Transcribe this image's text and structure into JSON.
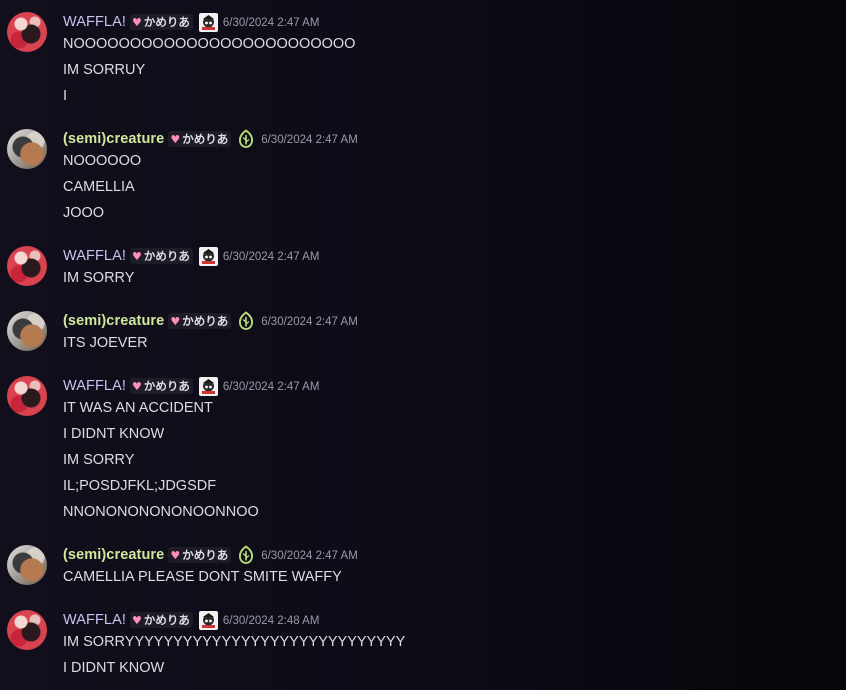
{
  "users": {
    "waffla": {
      "name": "WAFFLA!",
      "tag": "かめりあ",
      "color": "#c9c2f2"
    },
    "creature": {
      "name": "(semi)creature",
      "tag": "かめりあ",
      "color": "#cfe89c"
    }
  },
  "icons": {
    "tag_heart": "heart-icon",
    "waffla_role": "anime-character-role-icon",
    "creature_role": "leaf-role-icon"
  },
  "messages": [
    {
      "author": "WAFFLA!",
      "tag": "かめりあ",
      "timestamp": "6/30/2024 2:47 AM",
      "lines": [
        "NOOOOOOOOOOOOOOOOOOOOOOOOO",
        "IM SORRUY",
        "I"
      ]
    },
    {
      "author": "(semi)creature",
      "tag": "かめりあ",
      "timestamp": "6/30/2024 2:47 AM",
      "lines": [
        "NOOOOOO",
        "CAMELLIA",
        "JOOO"
      ]
    },
    {
      "author": "WAFFLA!",
      "tag": "かめりあ",
      "timestamp": "6/30/2024 2:47 AM",
      "lines": [
        "IM SORRY"
      ]
    },
    {
      "author": "(semi)creature",
      "tag": "かめりあ",
      "timestamp": "6/30/2024 2:47 AM",
      "lines": [
        "ITS JOEVER"
      ]
    },
    {
      "author": "WAFFLA!",
      "tag": "かめりあ",
      "timestamp": "6/30/2024 2:47 AM",
      "lines": [
        "IT WAS AN ACCIDENT",
        "I DIDNT KNOW",
        "IM SORRY",
        "IL;POSDJFKL;JDGSDF",
        "NNONONONONONOONNOO"
      ]
    },
    {
      "author": "(semi)creature",
      "tag": "かめりあ",
      "timestamp": "6/30/2024 2:47 AM",
      "lines": [
        "CAMELLIA PLEASE DONT SMITE WAFFY"
      ]
    },
    {
      "author": "WAFFLA!",
      "tag": "かめりあ",
      "timestamp": "6/30/2024 2:48 AM",
      "lines": [
        "IM SORRYYYYYYYYYYYYYYYYYYYYYYYYYYYYY",
        "I DIDNT KNOW"
      ]
    }
  ]
}
